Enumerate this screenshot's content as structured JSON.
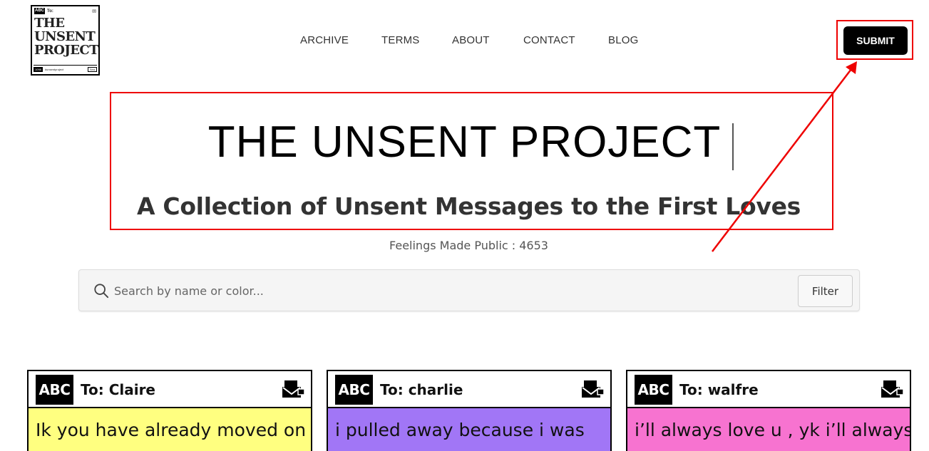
{
  "logo": {
    "abc": "ABC",
    "to": "To:",
    "line1": "THE",
    "line2": "UNSENT",
    "line3": "PROJECT",
    "footer_tag": "1098",
    "footer_hashtag": "#unsentproject",
    "footer_end": "Sea"
  },
  "nav": [
    {
      "label": "ARCHIVE"
    },
    {
      "label": "TERMS"
    },
    {
      "label": "ABOUT"
    },
    {
      "label": "CONTACT"
    },
    {
      "label": "BLOG"
    }
  ],
  "submit_label": "SUBMIT",
  "hero": {
    "title": "THE UNSENT PROJECT",
    "subtitle": "A Collection of Unsent Messages to the First Loves"
  },
  "feelings_count": "Feelings Made Public : 4653",
  "search": {
    "placeholder": "Search by name or color...",
    "value": "",
    "filter_label": "Filter"
  },
  "cards": [
    {
      "abc": "ABC",
      "to": "To: Claire",
      "text": "Ik you have already moved on",
      "color": "#ffff80"
    },
    {
      "abc": "ABC",
      "to": "To: charlie",
      "text": "i pulled away because i was",
      "color": "#a176f6"
    },
    {
      "abc": "ABC",
      "to": "To: walfre",
      "text": "i’ll always love u , yk i’ll always",
      "color": "#f773d0"
    }
  ],
  "colors": {
    "annotation": "#ee0000",
    "submit_bg": "#000000"
  },
  "icons": {
    "search": "search-icon",
    "mail": "mail-icon"
  }
}
